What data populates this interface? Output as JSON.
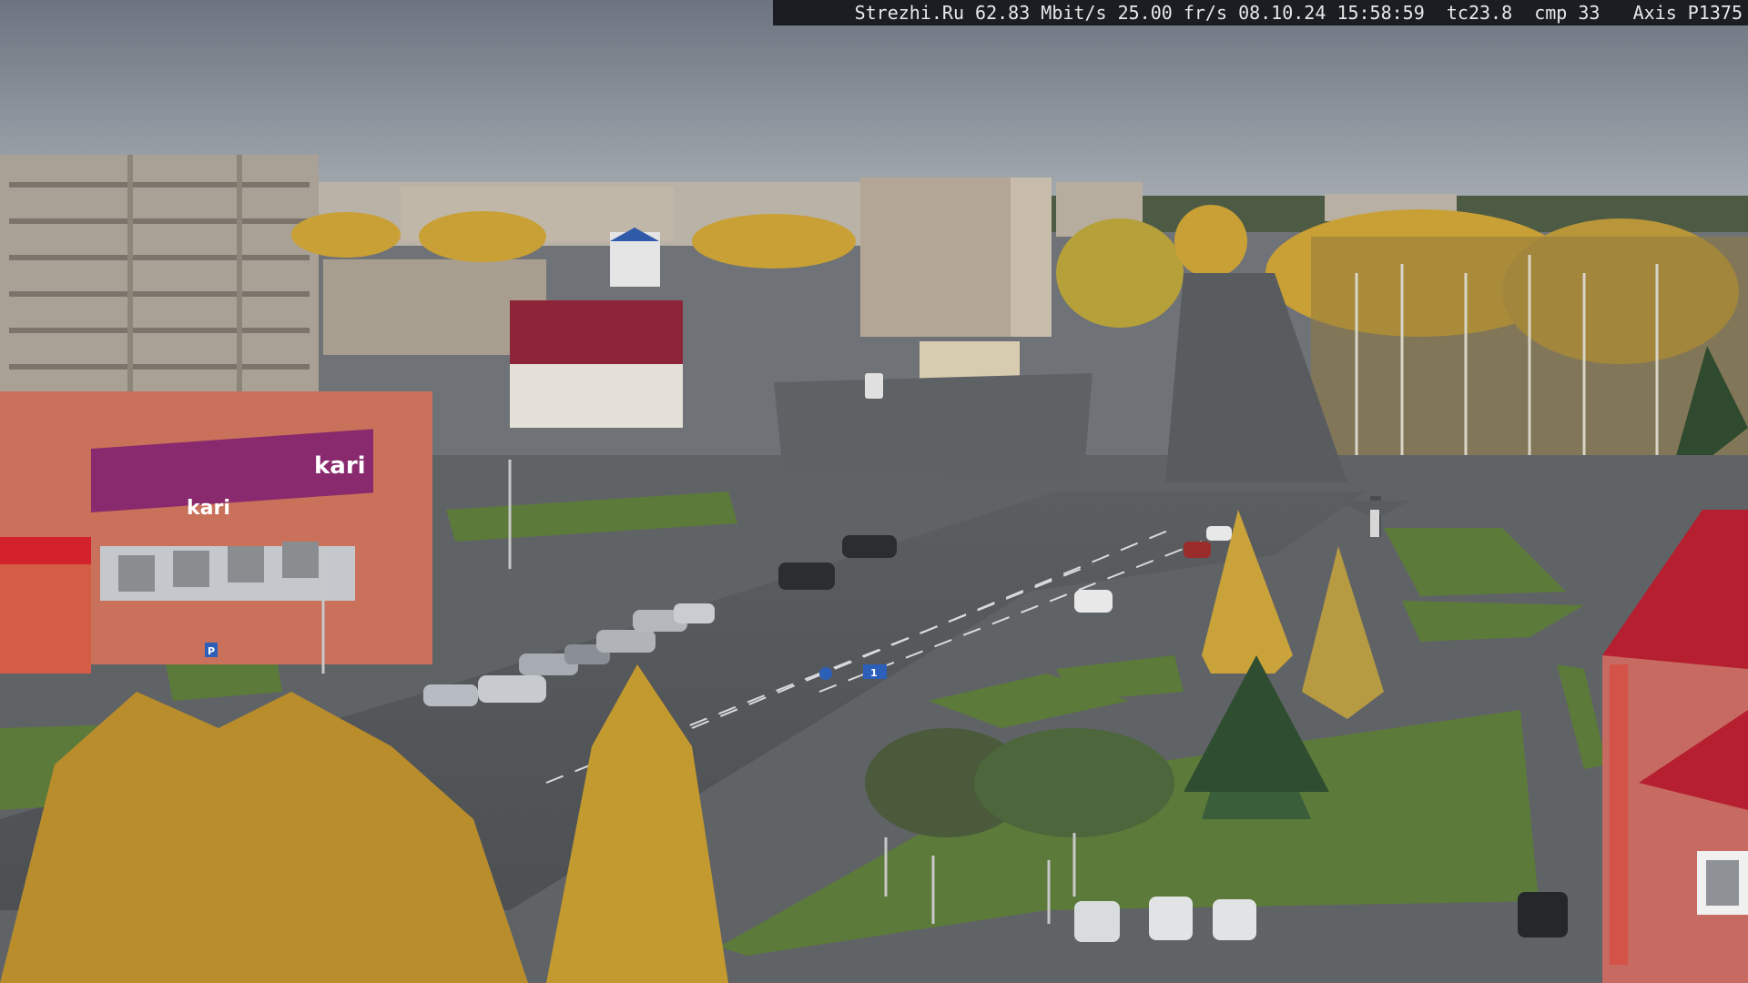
{
  "overlay": {
    "site": "Strezhi.Ru",
    "bitrate": "62.83 Mbit/s",
    "framerate": "25.00 fr/s",
    "date": "08.10.24",
    "time": "15:58:59",
    "tc": "tc23.8",
    "cmp": "cmp 33",
    "camera": "Axis P1375"
  },
  "signs": {
    "store_brand": "kari",
    "store_banner": "kari",
    "parking_sign": "P",
    "lane_sign": "1"
  },
  "colors": {
    "sky": "#8b9198",
    "road": "#55585b",
    "grass": "#5c7a3a",
    "foliage": "#c9a035",
    "building_red": "#a3263a",
    "store_purple": "#8a2a6e"
  }
}
